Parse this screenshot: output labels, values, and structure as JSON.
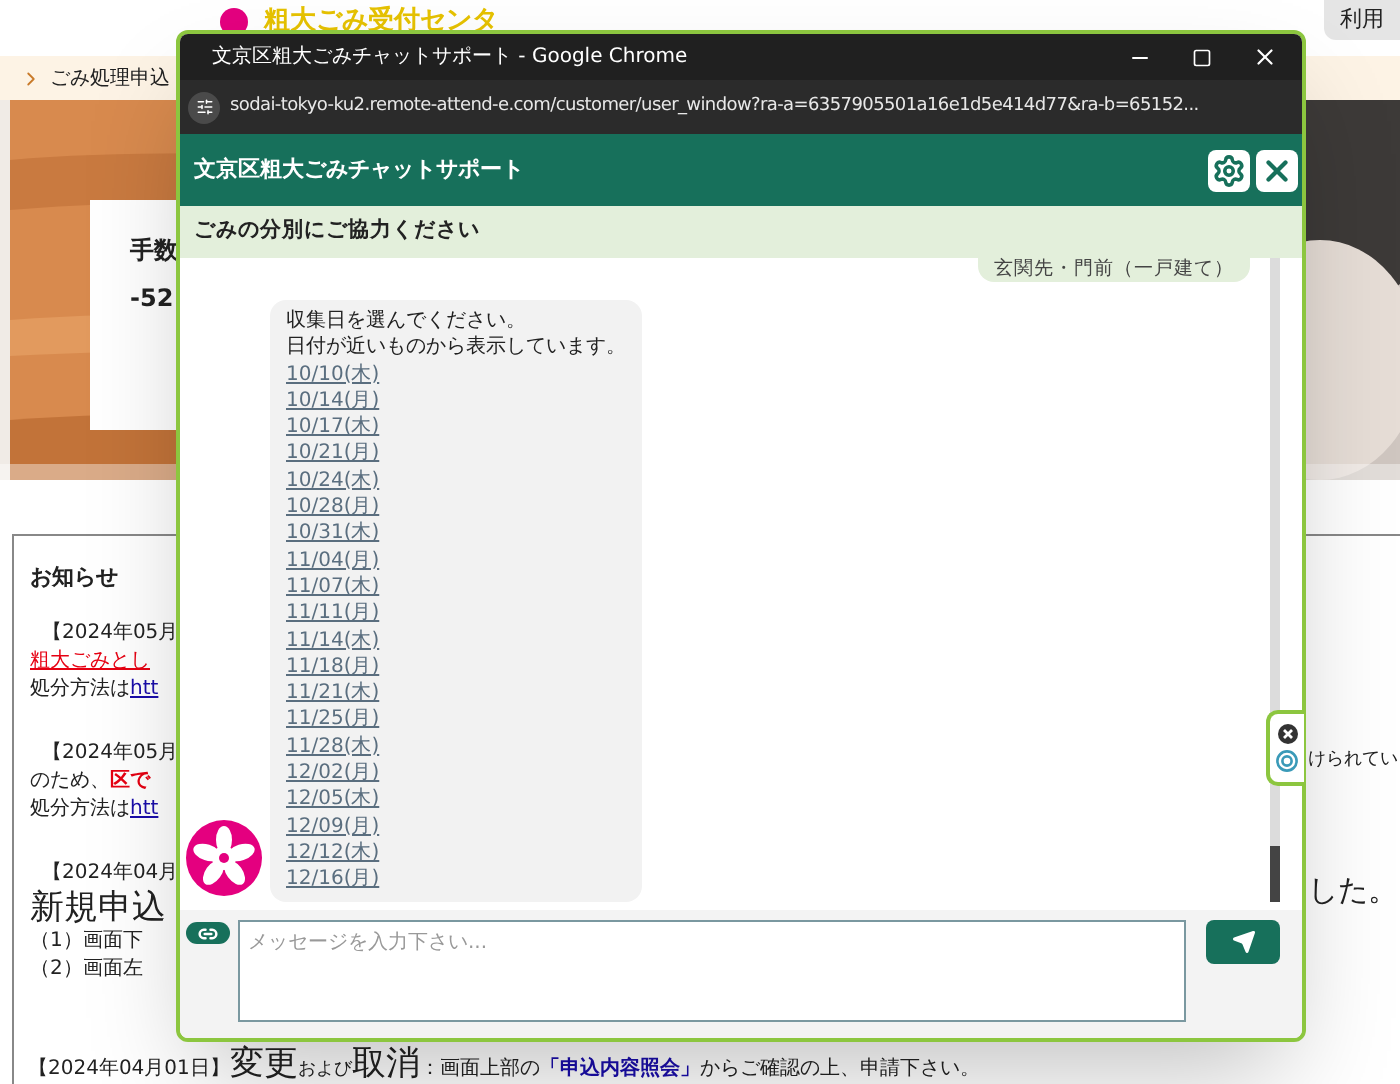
{
  "background": {
    "banner_title": "粗大ごみ受付センタ",
    "top_button": "利用",
    "breadcrumb": "ごみ処理申込",
    "card_lines": [
      "手数",
      "-52"
    ],
    "notice": {
      "heading": "お知らせ",
      "items": [
        {
          "lines": [
            [
              {
                "text": "【2024年05月",
                "kind": "plain"
              }
            ],
            [
              {
                "text": "粗大ごみとし",
                "kind": "alert-underline"
              }
            ],
            [
              {
                "text": "処分方法は",
                "kind": "plain"
              },
              {
                "text": "htt",
                "kind": "link"
              }
            ]
          ]
        },
        {
          "lines": [
            [
              {
                "text": "【2024年05月",
                "kind": "plain"
              }
            ],
            [
              {
                "text": "のため、",
                "kind": "plain"
              },
              {
                "text": "区で",
                "kind": "alert"
              }
            ],
            [
              {
                "text": "処分方法は",
                "kind": "plain"
              },
              {
                "text": "htt",
                "kind": "link"
              }
            ]
          ]
        },
        {
          "lines": [
            [
              {
                "text": "【2024年04月",
                "kind": "plain"
              }
            ],
            [
              {
                "text": "新規申込",
                "kind": "large"
              }
            ],
            [
              {
                "text": "（1）画面下",
                "kind": "plain"
              }
            ],
            [
              {
                "text": "（2）画面左",
                "kind": "plain"
              }
            ]
          ]
        }
      ]
    },
    "right_fragments": [
      {
        "text": "けられてい",
        "kind": "plain"
      },
      {
        "text": "した。",
        "kind": "large"
      }
    ],
    "footer_line": [
      {
        "text": "【2024年04月01日】",
        "kind": "plain"
      },
      {
        "text": "変更",
        "kind": "large"
      },
      {
        "text": "および",
        "kind": "small"
      },
      {
        "text": "取消",
        "kind": "large"
      },
      {
        "text": "：画面上部の",
        "kind": "plain"
      },
      {
        "text": "「申込内容照会」",
        "kind": "link-bold"
      },
      {
        "text": "からご確認の上、申請下さい。",
        "kind": "plain"
      }
    ]
  },
  "popup": {
    "window_title": "文京区粗大ごみチャットサポート - Google Chrome",
    "url": "sodai-tokyo-ku2.remote-attend-e.com/customer/user_window?ra-a=6357905501a16e1d5e414d77&ra-b=65152...",
    "header_title": "文京区粗大ごみチャットサポート",
    "subheader": "ごみの分別にご協力ください",
    "user_message": "玄関先・門前（一戸建て）",
    "bot_message": {
      "lines": [
        "収集日を選んでください。",
        "日付が近いものから表示しています。"
      ],
      "dates": [
        "10/10(木)",
        "10/14(月)",
        "10/17(木)",
        "10/21(月)",
        "10/24(木)",
        "10/28(月)",
        "10/31(木)",
        "11/04(月)",
        "11/07(木)",
        "11/11(月)",
        "11/14(木)",
        "11/18(月)",
        "11/21(木)",
        "11/25(月)",
        "11/28(木)",
        "12/02(月)",
        "12/05(木)",
        "12/09(月)",
        "12/12(木)",
        "12/16(月)"
      ]
    },
    "input": {
      "placeholder": "メッセージを入力下さい..."
    }
  }
}
